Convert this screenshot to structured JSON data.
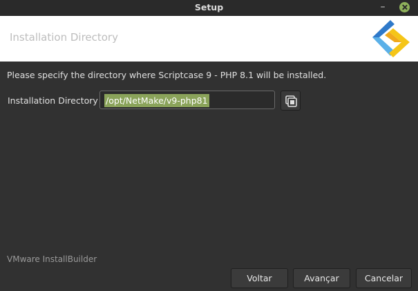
{
  "window": {
    "title": "Setup"
  },
  "header": {
    "heading": "Installation Directory",
    "logo_icon": "scriptcase-logo",
    "logo_colors": [
      "#2f79c9",
      "#f5c518",
      "#5ab0e8"
    ]
  },
  "content": {
    "instruction": "Please specify the directory where Scriptcase 9 - PHP 8.1 will be installed.",
    "directory_label": "Installation Directory",
    "directory_value": "/opt/NetMake/v9-php81",
    "selection_color": "#8aa35a",
    "browse_icon": "folder-browse-icon"
  },
  "footer": {
    "brand": "VMware InstallBuilder",
    "back_label": "Voltar",
    "next_label": "Avançar",
    "cancel_label": "Cancelar"
  },
  "colors": {
    "close_button": "#8fb15b"
  }
}
